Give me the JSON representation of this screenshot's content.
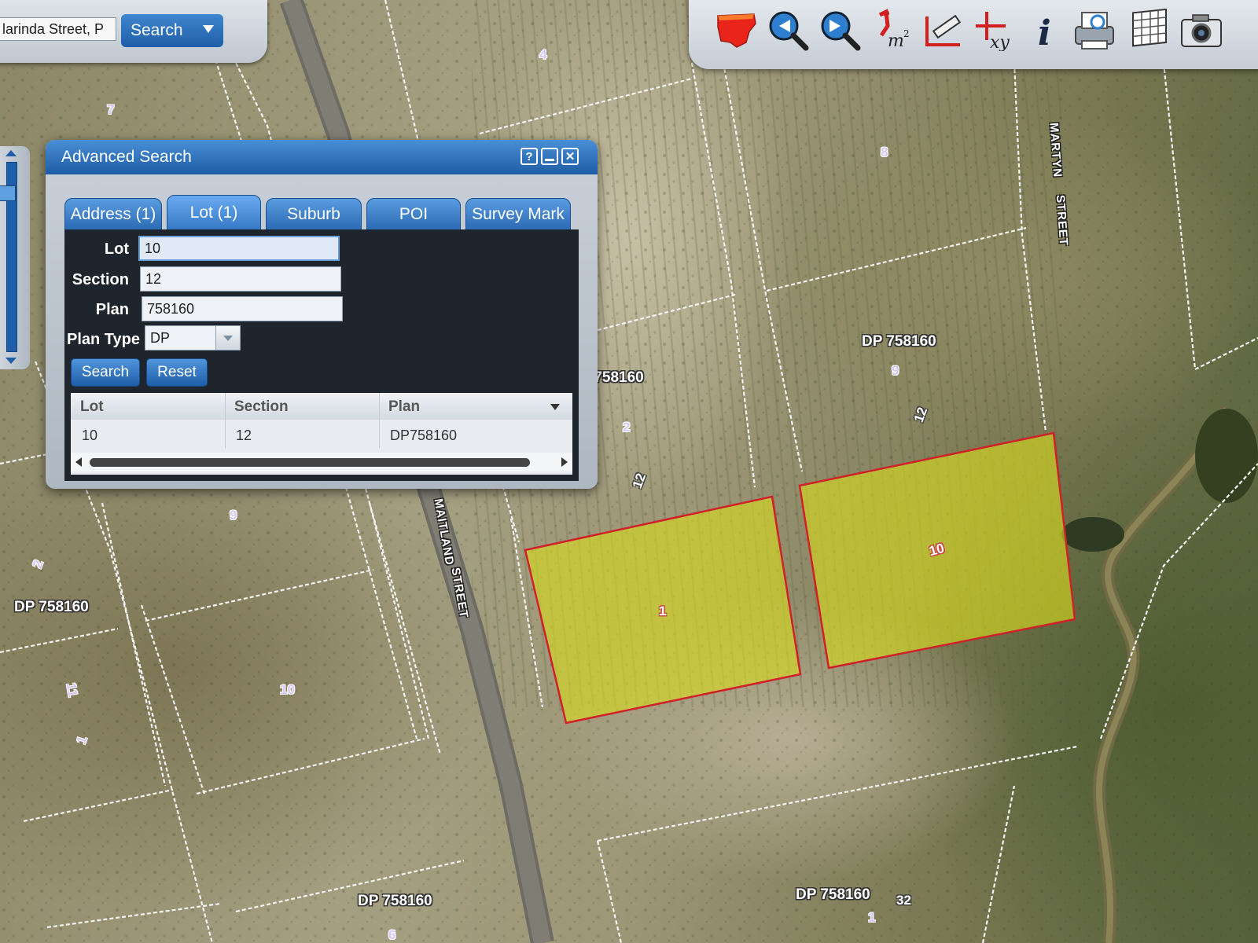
{
  "search_bar": {
    "address_value": "larinda Street, P",
    "button_label": "Search"
  },
  "dialog": {
    "title": "Advanced Search",
    "tabs": [
      {
        "label": "Address (1)"
      },
      {
        "label": "Lot (1)"
      },
      {
        "label": "Suburb"
      },
      {
        "label": "POI"
      },
      {
        "label": "Survey Mark"
      }
    ],
    "active_tab": "Lot (1)",
    "form": {
      "lot_label": "Lot",
      "lot_value": "10",
      "section_label": "Section",
      "section_value": "12",
      "plan_label": "Plan",
      "plan_value": "758160",
      "plan_type_label": "Plan Type",
      "plan_type_value": "DP"
    },
    "search_button": "Search",
    "reset_button": "Reset",
    "results": {
      "columns": [
        "Lot",
        "Section",
        "Plan"
      ],
      "rows": [
        [
          "10",
          "12",
          "DP758160"
        ]
      ]
    }
  },
  "map": {
    "dp_labels": [
      "DP 758160",
      "DP 758160",
      "DP 758160",
      "DP 758160",
      "DP 758160"
    ],
    "dp_partial": "DP 758160",
    "streets": [
      "MAITLAND",
      "STREET",
      "MARTYN",
      "STREET"
    ],
    "lot_numbers": [
      "4",
      "7",
      "8",
      "9",
      "2",
      "12",
      "1",
      "10",
      "9",
      "2",
      "10",
      "11",
      "1",
      "12",
      "1",
      "32",
      "6",
      "3"
    ]
  },
  "colors": {
    "accent": "#1f5ea8",
    "selected_parcel_fill": "#d8dc1e",
    "selected_parcel_border": "#d0202a"
  }
}
